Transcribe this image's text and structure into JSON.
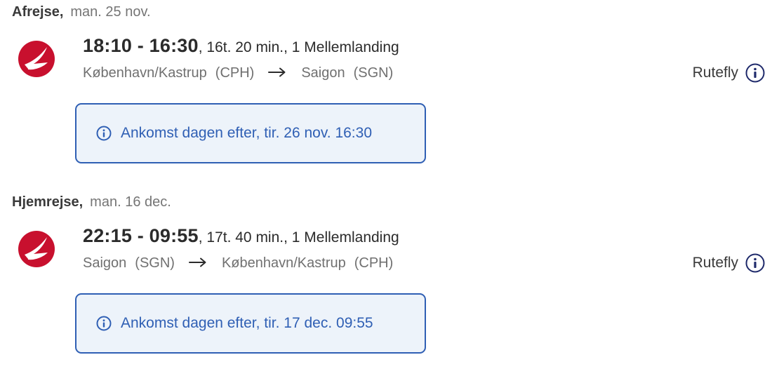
{
  "outbound": {
    "label": "Afrejse,",
    "date": "man. 25 nov.",
    "times": "18:10 - 16:30",
    "duration": ", 16t. 20 min., 1 Mellemlanding",
    "origin_city": "København/Kastrup",
    "origin_code": "(CPH)",
    "dest_city": "Saigon",
    "dest_code": "(SGN)",
    "flight_type": "Rutefly",
    "notice": "Ankomst dagen efter, tir. 26 nov. 16:30"
  },
  "return": {
    "label": "Hjemrejse,",
    "date": "man. 16 dec.",
    "times": "22:15 - 09:55",
    "duration": ", 17t. 40 min., 1 Mellemlanding",
    "origin_city": "Saigon",
    "origin_code": "(SGN)",
    "dest_city": "København/Kastrup",
    "dest_code": "(CPH)",
    "flight_type": "Rutefly",
    "notice": "Ankomst dagen efter, tir. 17 dec. 09:55"
  },
  "colors": {
    "airline_red": "#c8102e",
    "notice_border": "#2f5fb4",
    "notice_bg": "#edf3fa",
    "info_icon": "#1f2a6b"
  },
  "icons": {
    "airline_logo": "turkish-airlines-logo",
    "arrow": "arrow-right-icon",
    "info": "info-icon"
  }
}
